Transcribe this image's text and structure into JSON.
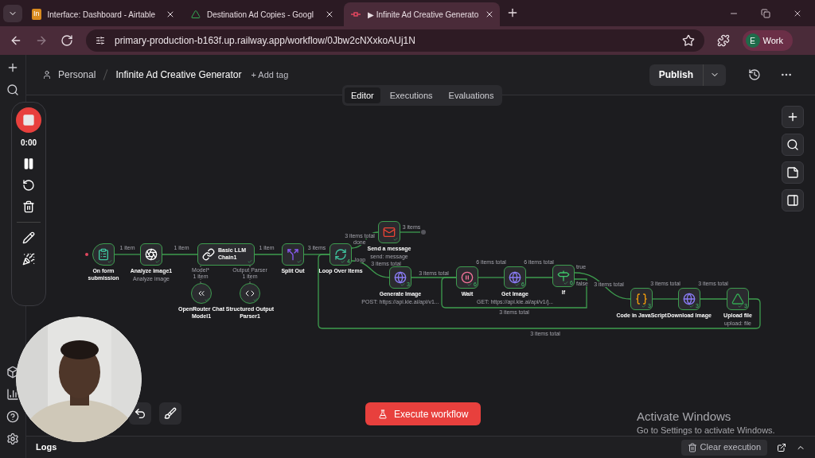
{
  "browser": {
    "tabs": [
      {
        "favicon": "In",
        "title": "Interface: Dashboard - Airtable",
        "selected": false
      },
      {
        "title": "Destination Ad Copies - Googl",
        "selected": false
      },
      {
        "title": "▶ Infinite Ad Creative Generato",
        "selected": true
      }
    ],
    "url": "primary-production-b163f.up.railway.app/workflow/0Jbw2cNXxkoAUj1N",
    "profile": {
      "initial": "E",
      "name": "Work"
    }
  },
  "header": {
    "breadcrumb": "Personal",
    "title": "Infinite Ad Creative Generator",
    "add_tag": "+ Add tag",
    "publish": "Publish"
  },
  "view_tabs": [
    {
      "label": "Editor",
      "selected": true
    },
    {
      "label": "Executions",
      "selected": false
    },
    {
      "label": "Evaluations",
      "selected": false
    }
  ],
  "nodes": [
    {
      "label": "On form submission",
      "kind": "trigger",
      "success": true
    },
    {
      "label": "Analyze image1",
      "subtitle": "Analyze image",
      "kind": "ai",
      "success": true
    },
    {
      "label": "Basic LLM Chain1",
      "kind": "chain",
      "success": true
    },
    {
      "label": "OpenRouter Chat Model1",
      "kind": "model",
      "success": true
    },
    {
      "label": "Structured Output Parser1",
      "kind": "parser",
      "success": true
    },
    {
      "label": "Split Out",
      "kind": "split",
      "success": true
    },
    {
      "label": "Loop Over Items",
      "kind": "loop",
      "success": true,
      "count": "4"
    },
    {
      "label": "Send a message",
      "subtitle": "send: message",
      "kind": "gmail",
      "success": true
    },
    {
      "label": "Generate Image",
      "subtitle": "POST: https://api.kie.ai/api/v1...",
      "kind": "http",
      "success": true,
      "count": "3"
    },
    {
      "label": "Wait",
      "kind": "wait",
      "success": true,
      "count": "6"
    },
    {
      "label": "Get Image",
      "subtitle": "GET: https://api.kie.ai/api/v1/j...",
      "kind": "http",
      "success": true,
      "count": "6"
    },
    {
      "label": "If",
      "kind": "if",
      "success": true,
      "count": "6"
    },
    {
      "label": "Code in JavaScript",
      "kind": "code",
      "success": true,
      "count": "3"
    },
    {
      "label": "Download Image",
      "kind": "http",
      "success": true,
      "count": "3"
    },
    {
      "label": "Upload file",
      "subtitle": "upload: file",
      "kind": "drive",
      "success": true,
      "count": "3"
    }
  ],
  "edge_labels": [
    "1 item",
    "1 item",
    "1 item",
    "3 items",
    "3 items total",
    "3 items",
    "3 items total",
    "3 items total",
    "6 items total",
    "6 items total",
    "3 items total",
    "3 items total",
    "3 items total",
    "3 items total",
    "3 items total"
  ],
  "port_labels": [
    "done",
    "loop",
    "true",
    "false",
    "Model*",
    "1 item",
    "Output Parser",
    "1 item"
  ],
  "execute_button": "Execute workflow",
  "logs": {
    "title": "Logs",
    "clear": "Clear execution"
  },
  "recorder": {
    "time": "0:00"
  },
  "os_notice": {
    "title": "Activate Windows",
    "text": "Go to Settings to activate Windows."
  }
}
